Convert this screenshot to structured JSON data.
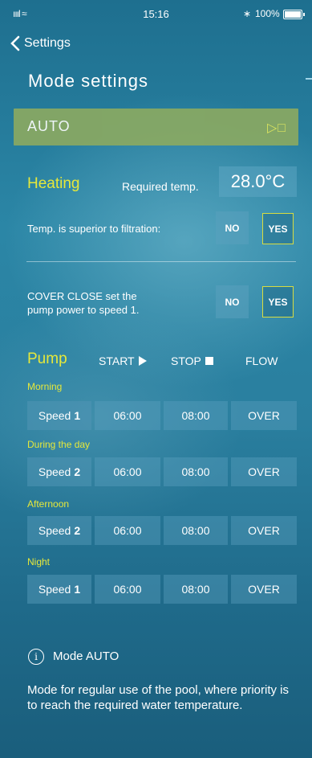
{
  "status_bar": {
    "signal": "ıııl ≈",
    "time": "15:16",
    "bluetooth": "∗",
    "battery": "100%"
  },
  "nav": {
    "back_label": "Settings"
  },
  "page": {
    "title": "Mode settings"
  },
  "mode_bar": {
    "label": "AUTO",
    "icons": "▷□"
  },
  "heating": {
    "label": "Heating",
    "required_label": "Required temp.",
    "required_value": "28.0°C"
  },
  "filtration": {
    "label": "Temp. is superior to filtration:",
    "no": "NO",
    "yes": "YES",
    "selected": "YES"
  },
  "cover": {
    "line1": "COVER CLOSE set the",
    "line2": "pump power to speed 1.",
    "no": "NO",
    "yes": "YES",
    "selected": "YES"
  },
  "pump": {
    "label": "Pump",
    "col_start": "START",
    "col_stop": "STOP",
    "col_flow": "FLOW",
    "periods": [
      {
        "name": "Morning",
        "speed_prefix": "Speed",
        "speed": "1",
        "start": "06:00",
        "stop": "08:00",
        "flow": "OVER"
      },
      {
        "name": "During the day",
        "speed_prefix": "Speed",
        "speed": "2",
        "start": "06:00",
        "stop": "08:00",
        "flow": "OVER"
      },
      {
        "name": "Afternoon",
        "speed_prefix": "Speed",
        "speed": "2",
        "start": "06:00",
        "stop": "08:00",
        "flow": "OVER"
      },
      {
        "name": "Night",
        "speed_prefix": "Speed",
        "speed": "1",
        "start": "06:00",
        "stop": "08:00",
        "flow": "OVER"
      }
    ]
  },
  "info": {
    "icon": "i",
    "title": "Mode AUTO",
    "text": "Mode for regular use of the pool, where priority is to reach the required water temperature."
  },
  "colors": {
    "accent_yellow": "#e6e83a",
    "auto_bar": "#8aa962"
  }
}
